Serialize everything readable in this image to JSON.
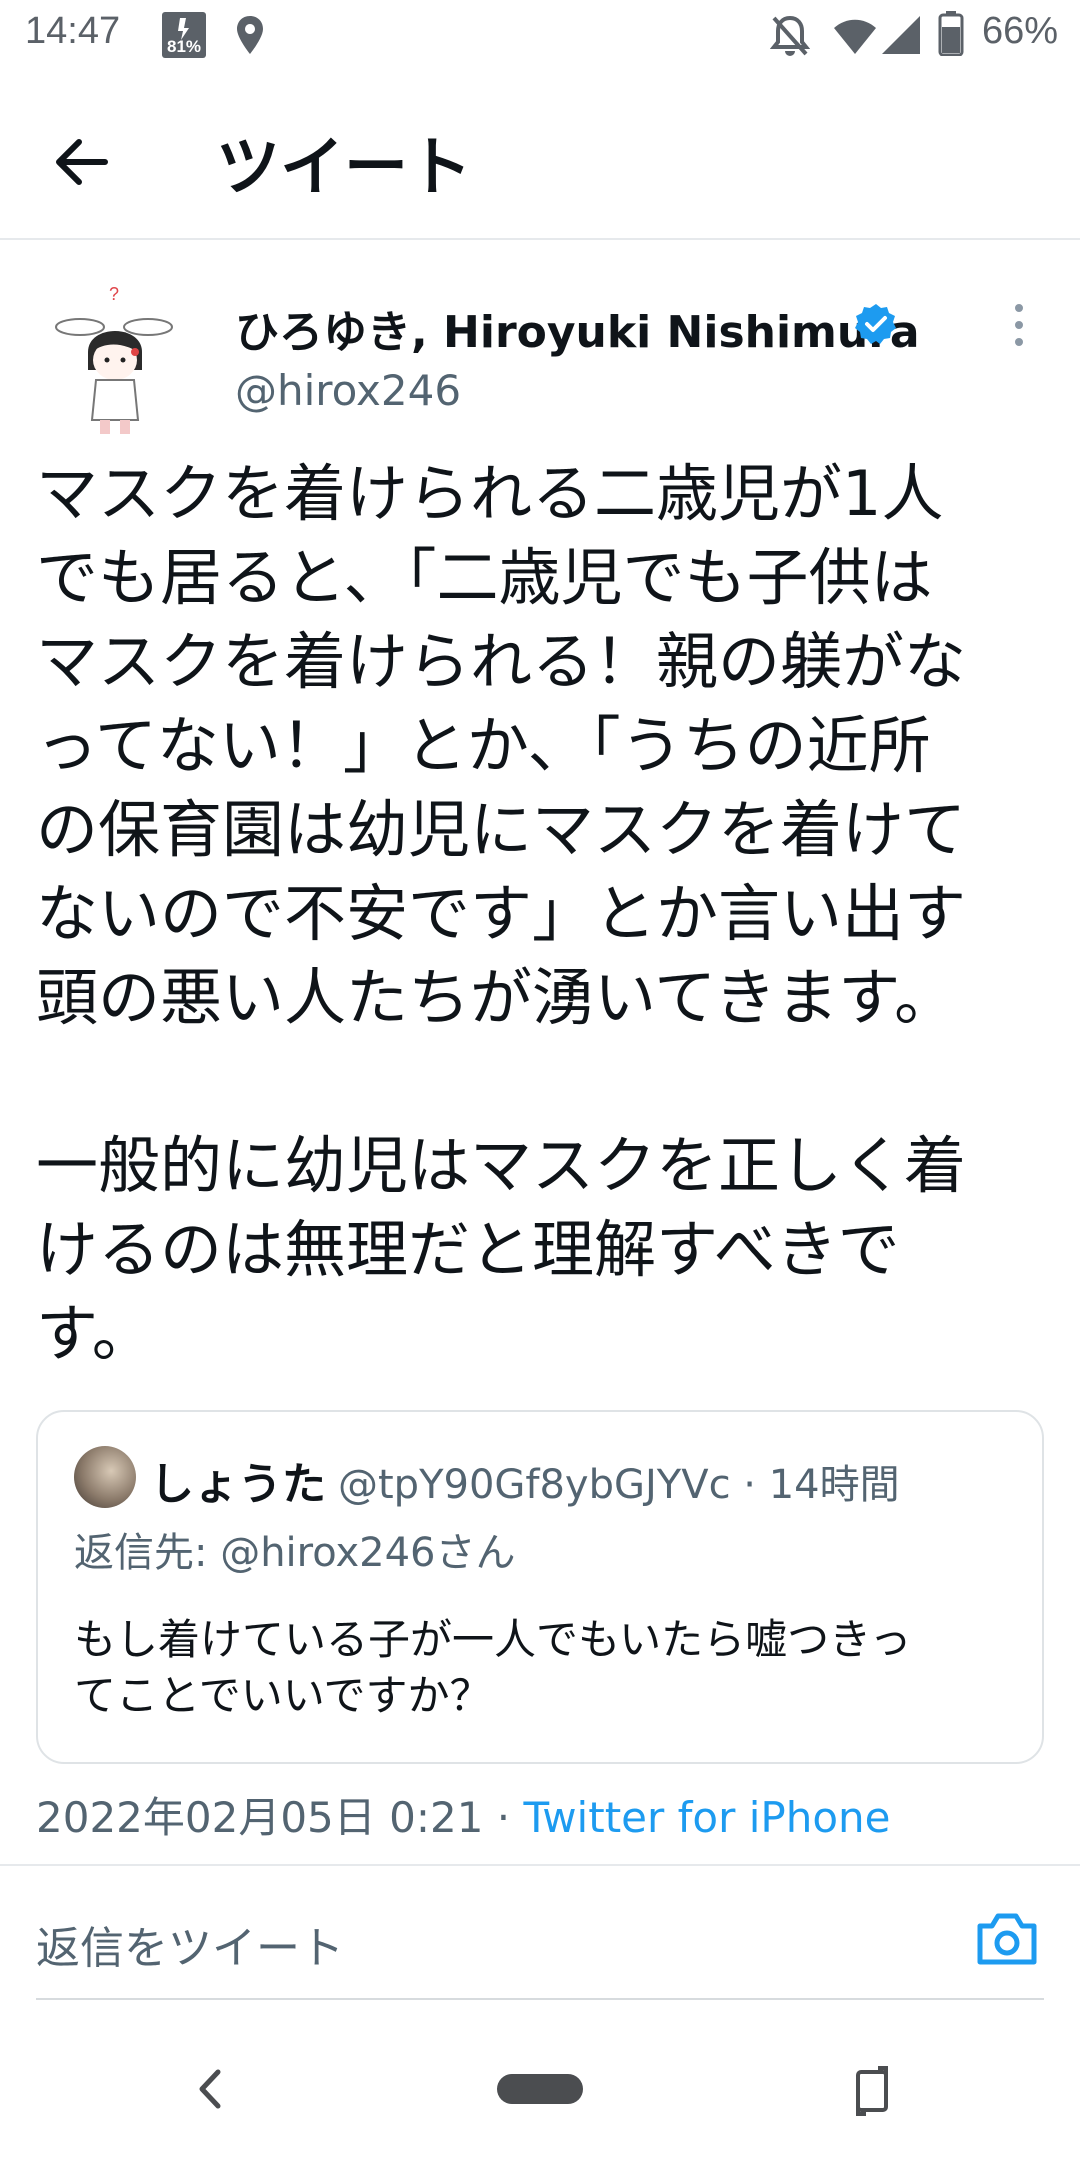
{
  "status_bar": {
    "time": "14:47",
    "battery_percent": "66%",
    "icons": [
      "notification-battery-81-icon",
      "location-icon",
      "mute-icon",
      "wifi-icon",
      "signal-icon",
      "battery-icon"
    ],
    "notification_badge": "81%"
  },
  "header": {
    "title": "ツイート",
    "back_icon": "arrow-left-icon"
  },
  "tweet": {
    "author_name": "ひろゆき, Hiroyuki Nishimura",
    "handle": "@hirox246",
    "verified": true,
    "text": "マスクを着けられる二歳児が1人\nでも居ると、「二歳児でも子供は\nマスクを着けられる！親の躾がな\nってない！」とか、「うちの近所\nの保育園は幼児にマスクを着けて\nないので不安です」とか言い出す\n頭の悪い人たちが湧いてきます。\n\n一般的に幼児はマスクを正しく着\nけるのは無理だと理解すべきで\nす。",
    "timestamp": "2022年02月05日 0:21 · ",
    "source": "Twitter for iPhone",
    "accent_color": "#1d9bf0"
  },
  "quote": {
    "name": "しょうた",
    "handle_time": "@tpY90Gf8ybGJYVc · 14時間",
    "reply_to": "返信先: @hirox246さん",
    "text": "もし着けている子が一人でもいたら嘘つきっ\nてことでいいですか？"
  },
  "reply_bar": {
    "placeholder": "返信をツイート",
    "camera_icon": "camera-icon"
  },
  "nav_bar": {
    "icons": [
      "nav-back-icon",
      "nav-home-pill",
      "rotate-icon"
    ]
  }
}
